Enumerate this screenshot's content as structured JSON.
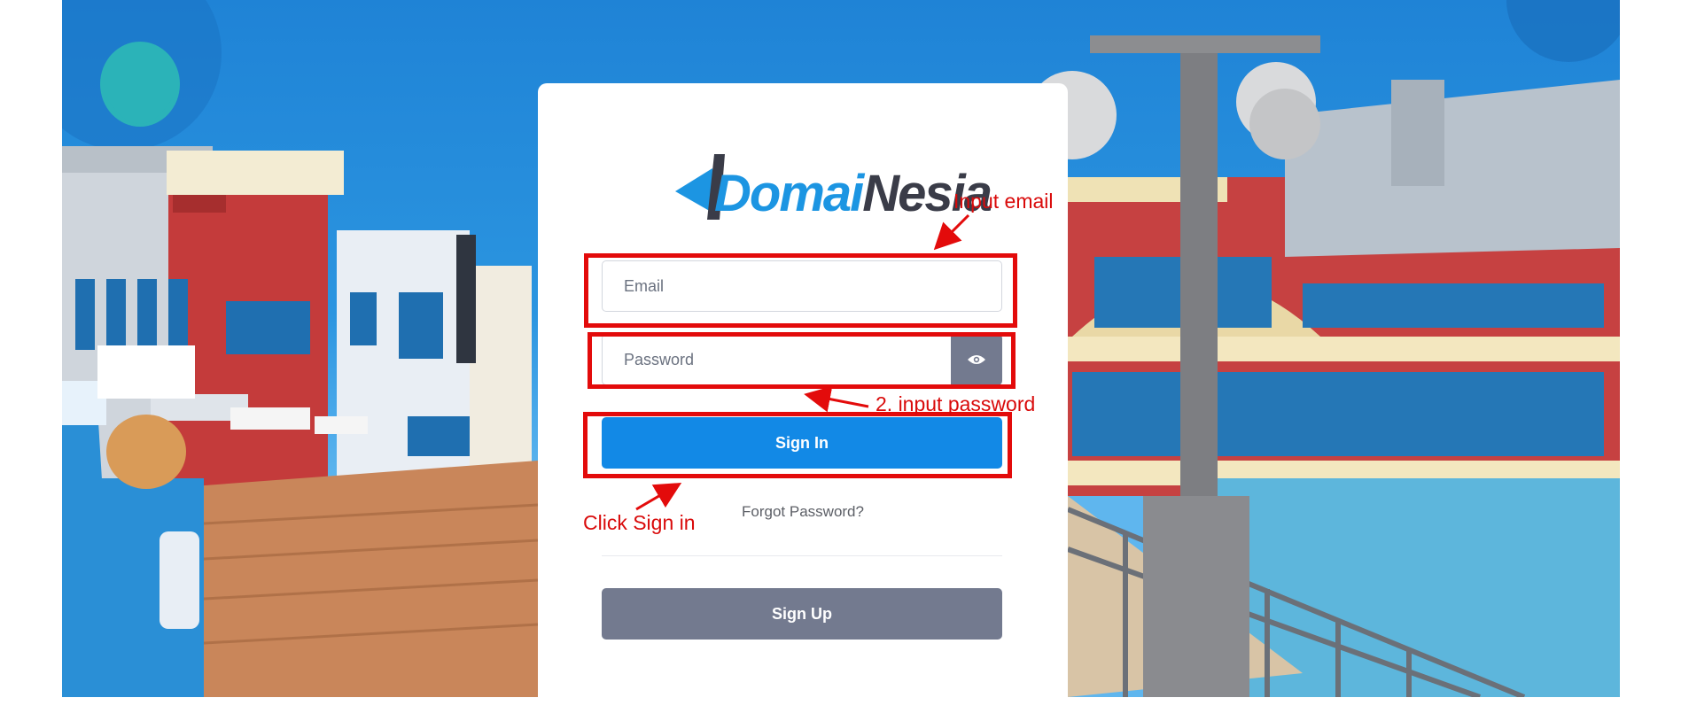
{
  "logo": {
    "part1": "Domai",
    "part2": "Nesia"
  },
  "form": {
    "email_placeholder": "Email",
    "password_placeholder": "Password",
    "sign_in_label": "Sign In",
    "forgot_label": "Forgot Password?",
    "sign_up_label": "Sign Up"
  },
  "annotations": {
    "email_note": "Input email",
    "password_note": "2. input password",
    "signin_note": "Click Sign in"
  },
  "icons": {
    "toggle_password": "eye-icon"
  },
  "colors": {
    "primary": "#1289e6",
    "secondary": "#737a8f",
    "annotation": "#e30b0b",
    "brand_blue": "#1c95e2",
    "brand_dark": "#3a3c48"
  }
}
